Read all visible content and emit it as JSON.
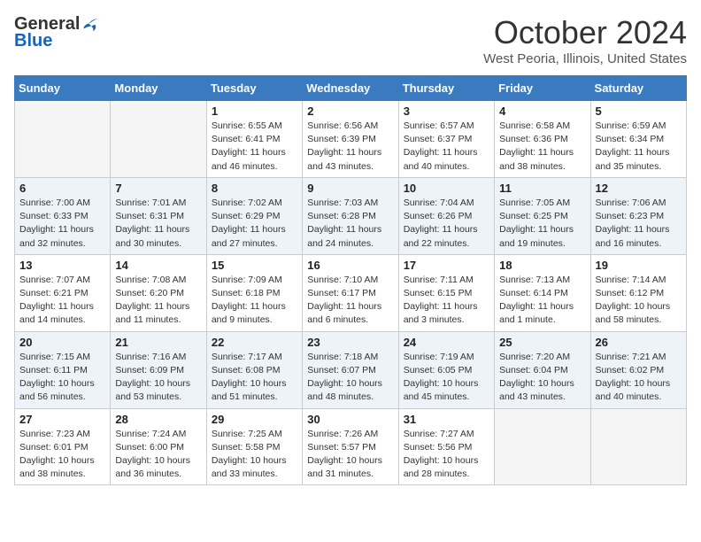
{
  "header": {
    "logo_general": "General",
    "logo_blue": "Blue",
    "month": "October 2024",
    "location": "West Peoria, Illinois, United States"
  },
  "weekdays": [
    "Sunday",
    "Monday",
    "Tuesday",
    "Wednesday",
    "Thursday",
    "Friday",
    "Saturday"
  ],
  "weeks": [
    [
      {
        "day": "",
        "info": ""
      },
      {
        "day": "",
        "info": ""
      },
      {
        "day": "1",
        "info": "Sunrise: 6:55 AM\nSunset: 6:41 PM\nDaylight: 11 hours and 46 minutes."
      },
      {
        "day": "2",
        "info": "Sunrise: 6:56 AM\nSunset: 6:39 PM\nDaylight: 11 hours and 43 minutes."
      },
      {
        "day": "3",
        "info": "Sunrise: 6:57 AM\nSunset: 6:37 PM\nDaylight: 11 hours and 40 minutes."
      },
      {
        "day": "4",
        "info": "Sunrise: 6:58 AM\nSunset: 6:36 PM\nDaylight: 11 hours and 38 minutes."
      },
      {
        "day": "5",
        "info": "Sunrise: 6:59 AM\nSunset: 6:34 PM\nDaylight: 11 hours and 35 minutes."
      }
    ],
    [
      {
        "day": "6",
        "info": "Sunrise: 7:00 AM\nSunset: 6:33 PM\nDaylight: 11 hours and 32 minutes."
      },
      {
        "day": "7",
        "info": "Sunrise: 7:01 AM\nSunset: 6:31 PM\nDaylight: 11 hours and 30 minutes."
      },
      {
        "day": "8",
        "info": "Sunrise: 7:02 AM\nSunset: 6:29 PM\nDaylight: 11 hours and 27 minutes."
      },
      {
        "day": "9",
        "info": "Sunrise: 7:03 AM\nSunset: 6:28 PM\nDaylight: 11 hours and 24 minutes."
      },
      {
        "day": "10",
        "info": "Sunrise: 7:04 AM\nSunset: 6:26 PM\nDaylight: 11 hours and 22 minutes."
      },
      {
        "day": "11",
        "info": "Sunrise: 7:05 AM\nSunset: 6:25 PM\nDaylight: 11 hours and 19 minutes."
      },
      {
        "day": "12",
        "info": "Sunrise: 7:06 AM\nSunset: 6:23 PM\nDaylight: 11 hours and 16 minutes."
      }
    ],
    [
      {
        "day": "13",
        "info": "Sunrise: 7:07 AM\nSunset: 6:21 PM\nDaylight: 11 hours and 14 minutes."
      },
      {
        "day": "14",
        "info": "Sunrise: 7:08 AM\nSunset: 6:20 PM\nDaylight: 11 hours and 11 minutes."
      },
      {
        "day": "15",
        "info": "Sunrise: 7:09 AM\nSunset: 6:18 PM\nDaylight: 11 hours and 9 minutes."
      },
      {
        "day": "16",
        "info": "Sunrise: 7:10 AM\nSunset: 6:17 PM\nDaylight: 11 hours and 6 minutes."
      },
      {
        "day": "17",
        "info": "Sunrise: 7:11 AM\nSunset: 6:15 PM\nDaylight: 11 hours and 3 minutes."
      },
      {
        "day": "18",
        "info": "Sunrise: 7:13 AM\nSunset: 6:14 PM\nDaylight: 11 hours and 1 minute."
      },
      {
        "day": "19",
        "info": "Sunrise: 7:14 AM\nSunset: 6:12 PM\nDaylight: 10 hours and 58 minutes."
      }
    ],
    [
      {
        "day": "20",
        "info": "Sunrise: 7:15 AM\nSunset: 6:11 PM\nDaylight: 10 hours and 56 minutes."
      },
      {
        "day": "21",
        "info": "Sunrise: 7:16 AM\nSunset: 6:09 PM\nDaylight: 10 hours and 53 minutes."
      },
      {
        "day": "22",
        "info": "Sunrise: 7:17 AM\nSunset: 6:08 PM\nDaylight: 10 hours and 51 minutes."
      },
      {
        "day": "23",
        "info": "Sunrise: 7:18 AM\nSunset: 6:07 PM\nDaylight: 10 hours and 48 minutes."
      },
      {
        "day": "24",
        "info": "Sunrise: 7:19 AM\nSunset: 6:05 PM\nDaylight: 10 hours and 45 minutes."
      },
      {
        "day": "25",
        "info": "Sunrise: 7:20 AM\nSunset: 6:04 PM\nDaylight: 10 hours and 43 minutes."
      },
      {
        "day": "26",
        "info": "Sunrise: 7:21 AM\nSunset: 6:02 PM\nDaylight: 10 hours and 40 minutes."
      }
    ],
    [
      {
        "day": "27",
        "info": "Sunrise: 7:23 AM\nSunset: 6:01 PM\nDaylight: 10 hours and 38 minutes."
      },
      {
        "day": "28",
        "info": "Sunrise: 7:24 AM\nSunset: 6:00 PM\nDaylight: 10 hours and 36 minutes."
      },
      {
        "day": "29",
        "info": "Sunrise: 7:25 AM\nSunset: 5:58 PM\nDaylight: 10 hours and 33 minutes."
      },
      {
        "day": "30",
        "info": "Sunrise: 7:26 AM\nSunset: 5:57 PM\nDaylight: 10 hours and 31 minutes."
      },
      {
        "day": "31",
        "info": "Sunrise: 7:27 AM\nSunset: 5:56 PM\nDaylight: 10 hours and 28 minutes."
      },
      {
        "day": "",
        "info": ""
      },
      {
        "day": "",
        "info": ""
      }
    ]
  ]
}
